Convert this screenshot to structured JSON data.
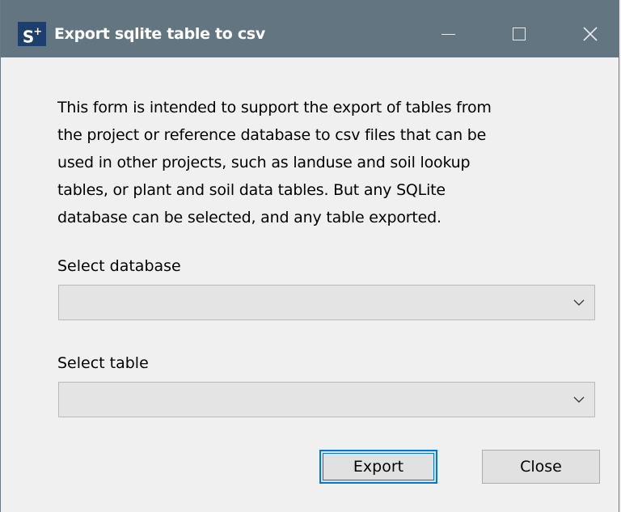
{
  "window": {
    "app_icon_text": "S",
    "app_icon_superscript": "+",
    "title": "Export sqlite table to csv",
    "controls": {
      "minimize_icon": "minimize-icon",
      "maximize_icon": "maximize-icon",
      "close_icon": "close-icon"
    },
    "colors": {
      "titlebar": "#627580",
      "app_icon_bg": "#1e3e6e",
      "body": "#f0f0f0",
      "focus_border": "#0078d7"
    }
  },
  "form": {
    "description": "This form is intended to support the export of tables from\nthe project or reference database to csv files that can be\nused in other projects, such as landuse and soil lookup\ntables, or plant and soil data tables. But any SQLite\ndatabase can be selected, and any table exported.",
    "database_label": "Select database",
    "database_value": "",
    "table_label": "Select table",
    "table_value": ""
  },
  "buttons": {
    "export_label": "Export",
    "close_label": "Close"
  }
}
